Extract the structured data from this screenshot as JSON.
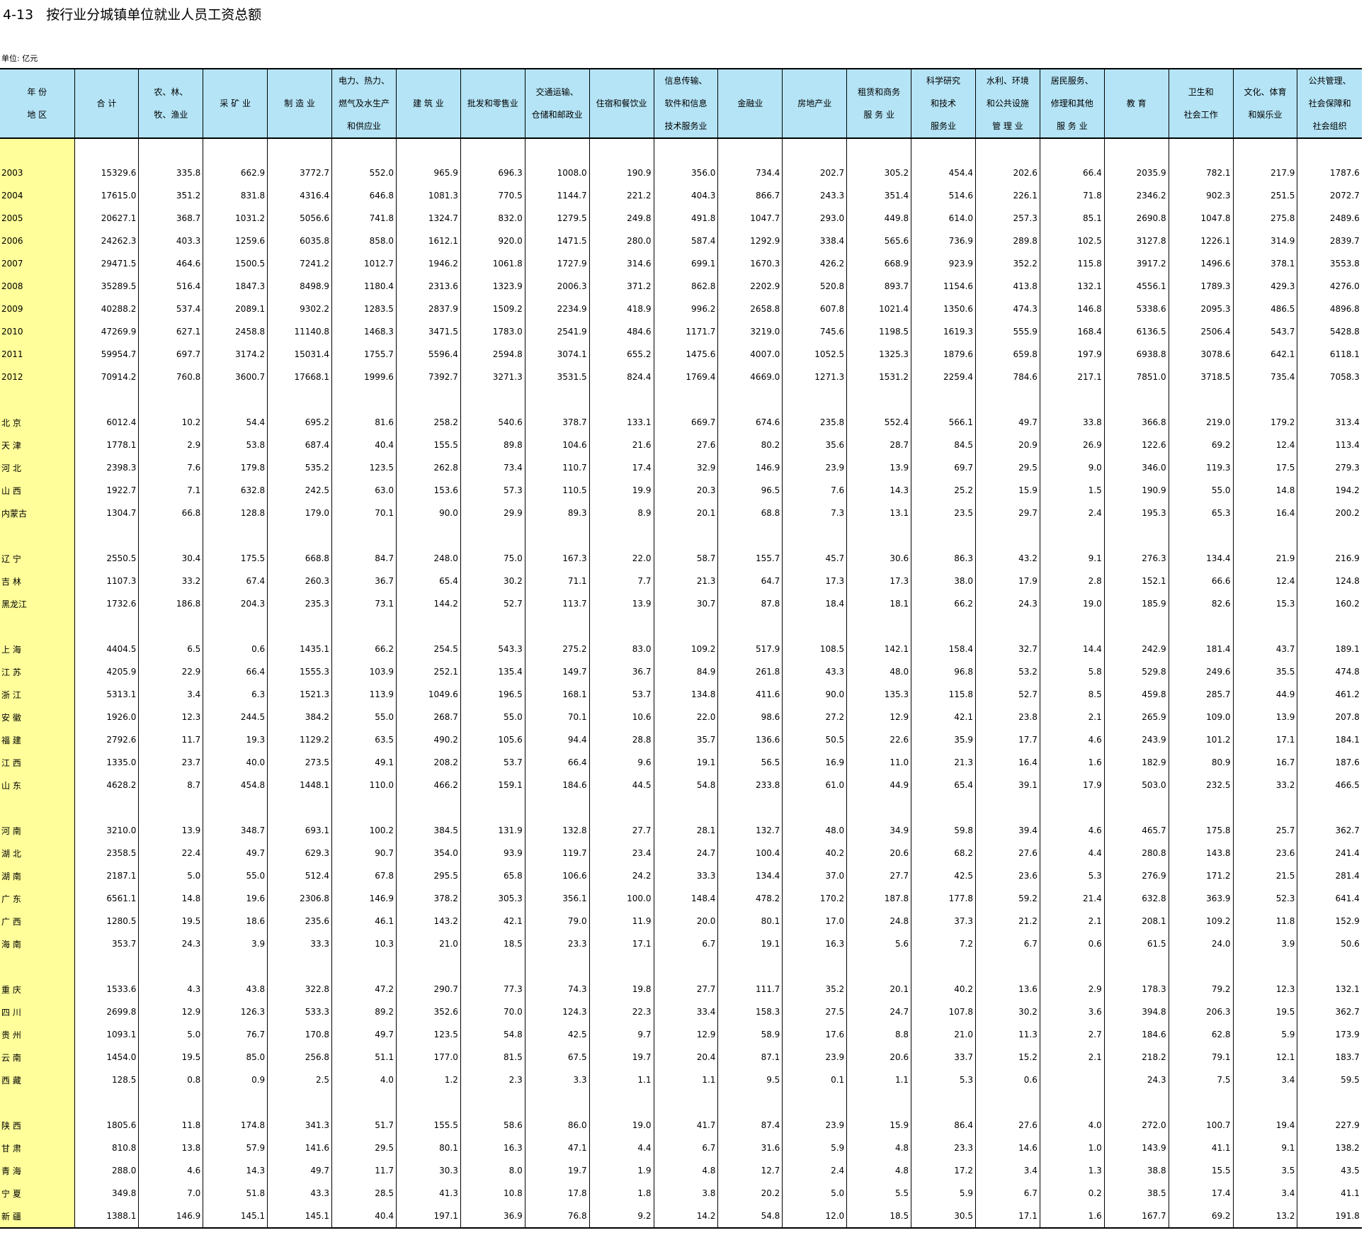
{
  "title": "4-13   按行业分城镇单位就业人员工资总额",
  "unit": "单位: 亿元",
  "headers": [
    "年  份\n地  区",
    "合  计",
    "农、林、\n牧、渔业",
    "采 矿 业",
    "制 造 业",
    "电力、热力、\n燃气及水生产\n和供应业",
    "建 筑 业",
    "批发和零售业",
    "交通运输、\n仓储和邮政业",
    "住宿和餐饮业",
    "信息传输、\n软件和信息\n技术服务业",
    "金融业",
    "房地产业",
    "租赁和商务\n服  务  业",
    "科学研究\n和技术\n服务业",
    "水利、环境\n和公共设施\n管  理  业",
    "居民服务、\n修理和其他\n服 务 业",
    "教    育",
    "卫生和\n社会工作",
    "文化、体育\n和娱乐业",
    "公共管理、\n社会保障和\n社会组织"
  ],
  "groups": [
    [
      [
        "2003",
        "15329.6",
        "335.8",
        "662.9",
        "3772.7",
        "552.0",
        "965.9",
        "696.3",
        "1008.0",
        "190.9",
        "356.0",
        "734.4",
        "202.7",
        "305.2",
        "454.4",
        "202.6",
        "66.4",
        "2035.9",
        "782.1",
        "217.9",
        "1787.6"
      ],
      [
        "2004",
        "17615.0",
        "351.2",
        "831.8",
        "4316.4",
        "646.8",
        "1081.3",
        "770.5",
        "1144.7",
        "221.2",
        "404.3",
        "866.7",
        "243.3",
        "351.4",
        "514.6",
        "226.1",
        "71.8",
        "2346.2",
        "902.3",
        "251.5",
        "2072.7"
      ],
      [
        "2005",
        "20627.1",
        "368.7",
        "1031.2",
        "5056.6",
        "741.8",
        "1324.7",
        "832.0",
        "1279.5",
        "249.8",
        "491.8",
        "1047.7",
        "293.0",
        "449.8",
        "614.0",
        "257.3",
        "85.1",
        "2690.8",
        "1047.8",
        "275.8",
        "2489.6"
      ],
      [
        "2006",
        "24262.3",
        "403.3",
        "1259.6",
        "6035.8",
        "858.0",
        "1612.1",
        "920.0",
        "1471.5",
        "280.0",
        "587.4",
        "1292.9",
        "338.4",
        "565.6",
        "736.9",
        "289.8",
        "102.5",
        "3127.8",
        "1226.1",
        "314.9",
        "2839.7"
      ],
      [
        "2007",
        "29471.5",
        "464.6",
        "1500.5",
        "7241.2",
        "1012.7",
        "1946.2",
        "1061.8",
        "1727.9",
        "314.6",
        "699.1",
        "1670.3",
        "426.2",
        "668.9",
        "923.9",
        "352.2",
        "115.8",
        "3917.2",
        "1496.6",
        "378.1",
        "3553.8"
      ],
      [
        "2008",
        "35289.5",
        "516.4",
        "1847.3",
        "8498.9",
        "1180.4",
        "2313.6",
        "1323.9",
        "2006.3",
        "371.2",
        "862.8",
        "2202.9",
        "520.8",
        "893.7",
        "1154.6",
        "413.8",
        "132.1",
        "4556.1",
        "1789.3",
        "429.3",
        "4276.0"
      ],
      [
        "2009",
        "40288.2",
        "537.4",
        "2089.1",
        "9302.2",
        "1283.5",
        "2837.9",
        "1509.2",
        "2234.9",
        "418.9",
        "996.2",
        "2658.8",
        "607.8",
        "1021.4",
        "1350.6",
        "474.3",
        "146.8",
        "5338.6",
        "2095.3",
        "486.5",
        "4896.8"
      ],
      [
        "2010",
        "47269.9",
        "627.1",
        "2458.8",
        "11140.8",
        "1468.3",
        "3471.5",
        "1783.0",
        "2541.9",
        "484.6",
        "1171.7",
        "3219.0",
        "745.6",
        "1198.5",
        "1619.3",
        "555.9",
        "168.4",
        "6136.5",
        "2506.4",
        "543.7",
        "5428.8"
      ],
      [
        "2011",
        "59954.7",
        "697.7",
        "3174.2",
        "15031.4",
        "1755.7",
        "5596.4",
        "2594.8",
        "3074.1",
        "655.2",
        "1475.6",
        "4007.0",
        "1052.5",
        "1325.3",
        "1879.6",
        "659.8",
        "197.9",
        "6938.8",
        "3078.6",
        "642.1",
        "6118.1"
      ],
      [
        "2012",
        "70914.2",
        "760.8",
        "3600.7",
        "17668.1",
        "1999.6",
        "7392.7",
        "3271.3",
        "3531.5",
        "824.4",
        "1769.4",
        "4669.0",
        "1271.3",
        "1531.2",
        "2259.4",
        "784.6",
        "217.1",
        "7851.0",
        "3718.5",
        "735.4",
        "7058.3"
      ]
    ],
    [
      [
        "北  京",
        "6012.4",
        "10.2",
        "54.4",
        "695.2",
        "81.6",
        "258.2",
        "540.6",
        "378.7",
        "133.1",
        "669.7",
        "674.6",
        "235.8",
        "552.4",
        "566.1",
        "49.7",
        "33.8",
        "366.8",
        "219.0",
        "179.2",
        "313.4"
      ],
      [
        "天  津",
        "1778.1",
        "2.9",
        "53.8",
        "687.4",
        "40.4",
        "155.5",
        "89.8",
        "104.6",
        "21.6",
        "27.6",
        "80.2",
        "35.6",
        "28.7",
        "84.5",
        "20.9",
        "26.9",
        "122.6",
        "69.2",
        "12.4",
        "113.4"
      ],
      [
        "河  北",
        "2398.3",
        "7.6",
        "179.8",
        "535.2",
        "123.5",
        "262.8",
        "73.4",
        "110.7",
        "17.4",
        "32.9",
        "146.9",
        "23.9",
        "13.9",
        "69.7",
        "29.5",
        "9.0",
        "346.0",
        "119.3",
        "17.5",
        "279.3"
      ],
      [
        "山  西",
        "1922.7",
        "7.1",
        "632.8",
        "242.5",
        "63.0",
        "153.6",
        "57.3",
        "110.5",
        "19.9",
        "20.3",
        "96.5",
        "7.6",
        "14.3",
        "25.2",
        "15.9",
        "1.5",
        "190.9",
        "55.0",
        "14.8",
        "194.2"
      ],
      [
        "内蒙古",
        "1304.7",
        "66.8",
        "128.8",
        "179.0",
        "70.1",
        "90.0",
        "29.9",
        "89.3",
        "8.9",
        "20.1",
        "68.8",
        "7.3",
        "13.1",
        "23.5",
        "29.7",
        "2.4",
        "195.3",
        "65.3",
        "16.4",
        "200.2"
      ]
    ],
    [
      [
        "辽  宁",
        "2550.5",
        "30.4",
        "175.5",
        "668.8",
        "84.7",
        "248.0",
        "75.0",
        "167.3",
        "22.0",
        "58.7",
        "155.7",
        "45.7",
        "30.6",
        "86.3",
        "43.2",
        "9.1",
        "276.3",
        "134.4",
        "21.9",
        "216.9"
      ],
      [
        "吉  林",
        "1107.3",
        "33.2",
        "67.4",
        "260.3",
        "36.7",
        "65.4",
        "30.2",
        "71.1",
        "7.7",
        "21.3",
        "64.7",
        "17.3",
        "17.3",
        "38.0",
        "17.9",
        "2.8",
        "152.1",
        "66.6",
        "12.4",
        "124.8"
      ],
      [
        "黑龙江",
        "1732.6",
        "186.8",
        "204.3",
        "235.3",
        "73.1",
        "144.2",
        "52.7",
        "113.7",
        "13.9",
        "30.7",
        "87.8",
        "18.4",
        "18.1",
        "66.2",
        "24.3",
        "19.0",
        "185.9",
        "82.6",
        "15.3",
        "160.2"
      ]
    ],
    [
      [
        "上  海",
        "4404.5",
        "6.5",
        "0.6",
        "1435.1",
        "66.2",
        "254.5",
        "543.3",
        "275.2",
        "83.0",
        "109.2",
        "517.9",
        "108.5",
        "142.1",
        "158.4",
        "32.7",
        "14.4",
        "242.9",
        "181.4",
        "43.7",
        "189.1"
      ],
      [
        "江  苏",
        "4205.9",
        "22.9",
        "66.4",
        "1555.3",
        "103.9",
        "252.1",
        "135.4",
        "149.7",
        "36.7",
        "84.9",
        "261.8",
        "43.3",
        "48.0",
        "96.8",
        "53.2",
        "5.8",
        "529.8",
        "249.6",
        "35.5",
        "474.8"
      ],
      [
        "浙  江",
        "5313.1",
        "3.4",
        "6.3",
        "1521.3",
        "113.9",
        "1049.6",
        "196.5",
        "168.1",
        "53.7",
        "134.8",
        "411.6",
        "90.0",
        "135.3",
        "115.8",
        "52.7",
        "8.5",
        "459.8",
        "285.7",
        "44.9",
        "461.2"
      ],
      [
        "安  徽",
        "1926.0",
        "12.3",
        "244.5",
        "384.2",
        "55.0",
        "268.7",
        "55.0",
        "70.1",
        "10.6",
        "22.0",
        "98.6",
        "27.2",
        "12.9",
        "42.1",
        "23.8",
        "2.1",
        "265.9",
        "109.0",
        "13.9",
        "207.8"
      ],
      [
        "福  建",
        "2792.6",
        "11.7",
        "19.3",
        "1129.2",
        "63.5",
        "490.2",
        "105.6",
        "94.4",
        "28.8",
        "35.7",
        "136.6",
        "50.5",
        "22.6",
        "35.9",
        "17.7",
        "4.6",
        "243.9",
        "101.2",
        "17.1",
        "184.1"
      ],
      [
        "江  西",
        "1335.0",
        "23.7",
        "40.0",
        "273.5",
        "49.1",
        "208.2",
        "53.7",
        "66.4",
        "9.6",
        "19.1",
        "56.5",
        "16.9",
        "11.0",
        "21.3",
        "16.4",
        "1.6",
        "182.9",
        "80.9",
        "16.7",
        "187.6"
      ],
      [
        "山  东",
        "4628.2",
        "8.7",
        "454.8",
        "1448.1",
        "110.0",
        "466.2",
        "159.1",
        "184.6",
        "44.5",
        "54.8",
        "233.8",
        "61.0",
        "44.9",
        "65.4",
        "39.1",
        "17.9",
        "503.0",
        "232.5",
        "33.2",
        "466.5"
      ]
    ],
    [
      [
        "河  南",
        "3210.0",
        "13.9",
        "348.7",
        "693.1",
        "100.2",
        "384.5",
        "131.9",
        "132.8",
        "27.7",
        "28.1",
        "132.7",
        "48.0",
        "34.9",
        "59.8",
        "39.4",
        "4.6",
        "465.7",
        "175.8",
        "25.7",
        "362.7"
      ],
      [
        "湖  北",
        "2358.5",
        "22.4",
        "49.7",
        "629.3",
        "90.7",
        "354.0",
        "93.9",
        "119.7",
        "23.4",
        "24.7",
        "100.4",
        "40.2",
        "20.6",
        "68.2",
        "27.6",
        "4.4",
        "280.8",
        "143.8",
        "23.6",
        "241.4"
      ],
      [
        "湖  南",
        "2187.1",
        "5.0",
        "55.0",
        "512.4",
        "67.8",
        "295.5",
        "65.8",
        "106.6",
        "24.2",
        "33.3",
        "134.4",
        "37.0",
        "27.7",
        "42.5",
        "23.6",
        "5.3",
        "276.9",
        "171.2",
        "21.5",
        "281.4"
      ],
      [
        "广  东",
        "6561.1",
        "14.8",
        "19.6",
        "2306.8",
        "146.9",
        "378.2",
        "305.3",
        "356.1",
        "100.0",
        "148.4",
        "478.2",
        "170.2",
        "187.8",
        "177.8",
        "59.2",
        "21.4",
        "632.8",
        "363.9",
        "52.3",
        "641.4"
      ],
      [
        "广  西",
        "1280.5",
        "19.5",
        "18.6",
        "235.6",
        "46.1",
        "143.2",
        "42.1",
        "79.0",
        "11.9",
        "20.0",
        "80.1",
        "17.0",
        "24.8",
        "37.3",
        "21.2",
        "2.1",
        "208.1",
        "109.2",
        "11.8",
        "152.9"
      ],
      [
        "海  南",
        "353.7",
        "24.3",
        "3.9",
        "33.3",
        "10.3",
        "21.0",
        "18.5",
        "23.3",
        "17.1",
        "6.7",
        "19.1",
        "16.3",
        "5.6",
        "7.2",
        "6.7",
        "0.6",
        "61.5",
        "24.0",
        "3.9",
        "50.6"
      ]
    ],
    [
      [
        "重  庆",
        "1533.6",
        "4.3",
        "43.8",
        "322.8",
        "47.2",
        "290.7",
        "77.3",
        "74.3",
        "19.8",
        "27.7",
        "111.7",
        "35.2",
        "20.1",
        "40.2",
        "13.6",
        "2.9",
        "178.3",
        "79.2",
        "12.3",
        "132.1"
      ],
      [
        "四  川",
        "2699.8",
        "12.9",
        "126.3",
        "533.3",
        "89.2",
        "352.6",
        "70.0",
        "124.3",
        "22.3",
        "33.4",
        "158.3",
        "27.5",
        "24.7",
        "107.8",
        "30.2",
        "3.6",
        "394.8",
        "206.3",
        "19.5",
        "362.7"
      ],
      [
        "贵  州",
        "1093.1",
        "5.0",
        "76.7",
        "170.8",
        "49.7",
        "123.5",
        "54.8",
        "42.5",
        "9.7",
        "12.9",
        "58.9",
        "17.6",
        "8.8",
        "21.0",
        "11.3",
        "2.7",
        "184.6",
        "62.8",
        "5.9",
        "173.9"
      ],
      [
        "云  南",
        "1454.0",
        "19.5",
        "85.0",
        "256.8",
        "51.1",
        "177.0",
        "81.5",
        "67.5",
        "19.7",
        "20.4",
        "87.1",
        "23.9",
        "20.6",
        "33.7",
        "15.2",
        "2.1",
        "218.2",
        "79.1",
        "12.1",
        "183.7"
      ],
      [
        "西  藏",
        "128.5",
        "0.8",
        "0.9",
        "2.5",
        "4.0",
        "1.2",
        "2.3",
        "3.3",
        "1.1",
        "1.1",
        "9.5",
        "0.1",
        "1.1",
        "5.3",
        "0.6",
        "",
        "24.3",
        "7.5",
        "3.4",
        "59.5"
      ]
    ],
    [
      [
        "陕  西",
        "1805.6",
        "11.8",
        "174.8",
        "341.3",
        "51.7",
        "155.5",
        "58.6",
        "86.0",
        "19.0",
        "41.7",
        "87.4",
        "23.9",
        "15.9",
        "86.4",
        "27.6",
        "4.0",
        "272.0",
        "100.7",
        "19.4",
        "227.9"
      ],
      [
        "甘  肃",
        "810.8",
        "13.8",
        "57.9",
        "141.6",
        "29.5",
        "80.1",
        "16.3",
        "47.1",
        "4.4",
        "6.7",
        "31.6",
        "5.9",
        "4.8",
        "23.3",
        "14.6",
        "1.0",
        "143.9",
        "41.1",
        "9.1",
        "138.2"
      ],
      [
        "青  海",
        "288.0",
        "4.6",
        "14.3",
        "49.7",
        "11.7",
        "30.3",
        "8.0",
        "19.7",
        "1.9",
        "4.8",
        "12.7",
        "2.4",
        "4.8",
        "17.2",
        "3.4",
        "1.3",
        "38.8",
        "15.5",
        "3.5",
        "43.5"
      ],
      [
        "宁  夏",
        "349.8",
        "7.0",
        "51.8",
        "43.3",
        "28.5",
        "41.3",
        "10.8",
        "17.8",
        "1.8",
        "3.8",
        "20.2",
        "5.0",
        "5.5",
        "5.9",
        "6.7",
        "0.2",
        "38.5",
        "17.4",
        "3.4",
        "41.1"
      ],
      [
        "新  疆",
        "1388.1",
        "146.9",
        "145.1",
        "145.1",
        "40.4",
        "197.1",
        "36.9",
        "76.8",
        "9.2",
        "14.2",
        "54.8",
        "12.0",
        "18.5",
        "30.5",
        "17.1",
        "1.6",
        "167.7",
        "69.2",
        "13.2",
        "191.8"
      ]
    ]
  ]
}
